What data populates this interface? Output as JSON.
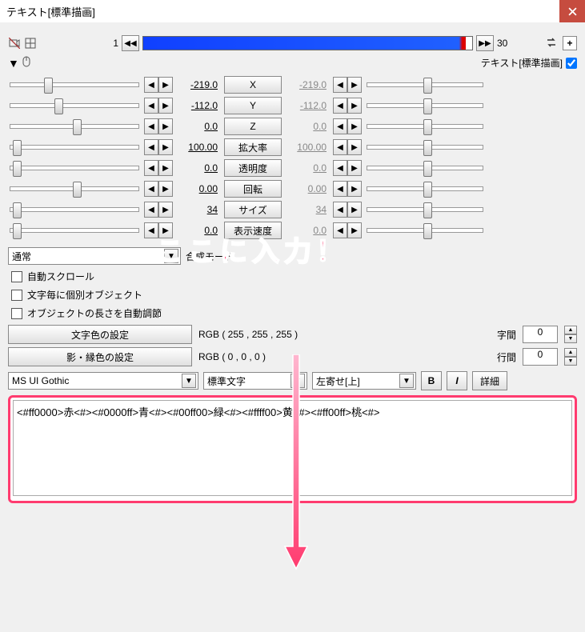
{
  "window": {
    "title": "テキスト[標準描画]"
  },
  "timeline": {
    "start": "1",
    "end": "30"
  },
  "object_row": {
    "label": "テキスト[標準描画]"
  },
  "params": [
    {
      "label": "X",
      "left": "-219.0",
      "right": "-219.0",
      "thumbL": 42,
      "thumbR": 70
    },
    {
      "label": "Y",
      "left": "-112.0",
      "right": "-112.0",
      "thumbL": 55,
      "thumbR": 70
    },
    {
      "label": "Z",
      "left": "0.0",
      "right": "0.0",
      "thumbL": 78,
      "thumbR": 70
    },
    {
      "label": "拡大率",
      "left": "100.00",
      "right": "100.00",
      "thumbL": 3,
      "thumbR": 70
    },
    {
      "label": "透明度",
      "left": "0.0",
      "right": "0.0",
      "thumbL": 3,
      "thumbR": 70
    },
    {
      "label": "回転",
      "left": "0.00",
      "right": "0.00",
      "thumbL": 78,
      "thumbR": 70
    },
    {
      "label": "サイズ",
      "left": "34",
      "right": "34",
      "thumbL": 3,
      "thumbR": 70
    },
    {
      "label": "表示速度",
      "left": "0.0",
      "right": "0.0",
      "thumbL": 3,
      "thumbR": 70
    }
  ],
  "blend_mode": {
    "label": "合成モード",
    "value": "通常"
  },
  "checks": {
    "autoscroll": "自動スクロール",
    "per_char": "文字毎に個別オブジェクト",
    "auto_len": "オブジェクトの長さを自動調節"
  },
  "color_btn": "文字色の設定",
  "shadow_btn": "影・縁色の設定",
  "rgb_text": "RGB ( 255 , 255 , 255 )",
  "rgb_shadow": "RGB ( 0 , 0 , 0 )",
  "spacing": {
    "char_label": "字間",
    "char_val": "0",
    "line_label": "行間",
    "line_val": "0"
  },
  "font": {
    "family": "MS UI Gothic",
    "style": "標準文字",
    "align": "左寄せ[上]",
    "b": "B",
    "i": "I",
    "detail": "詳細"
  },
  "textarea": "<#ff0000>赤<#><#0000ff>青<#><#00ff00>緑<#><#ffff00>黄<#><#ff00ff>桃<#>",
  "annotation": "ここに入力！"
}
